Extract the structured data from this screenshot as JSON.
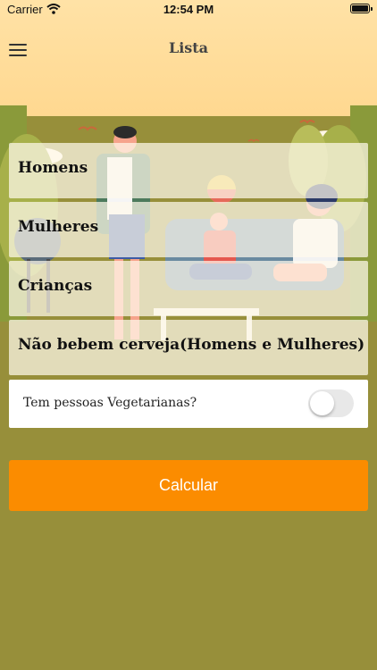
{
  "status_bar": {
    "carrier": "Carrier",
    "time": "12:54 PM",
    "wifi_icon": "wifi-icon",
    "battery_icon": "battery-icon"
  },
  "nav": {
    "title": "Lista",
    "menu_icon": "hamburger-menu-icon"
  },
  "form": {
    "fields": [
      {
        "label": "Homens"
      },
      {
        "label": "Mulheres"
      },
      {
        "label": "Crianças"
      },
      {
        "label": "Não bebem cerveja(Homens e Mulheres)"
      }
    ],
    "vegetarian_toggle": {
      "label": "Tem pessoas Vegetarianas?",
      "on": false
    },
    "submit_label": "Calcular"
  },
  "colors": {
    "accent": "#fb8c00",
    "background": "#978f3a",
    "sky": "#ffe2a6"
  }
}
